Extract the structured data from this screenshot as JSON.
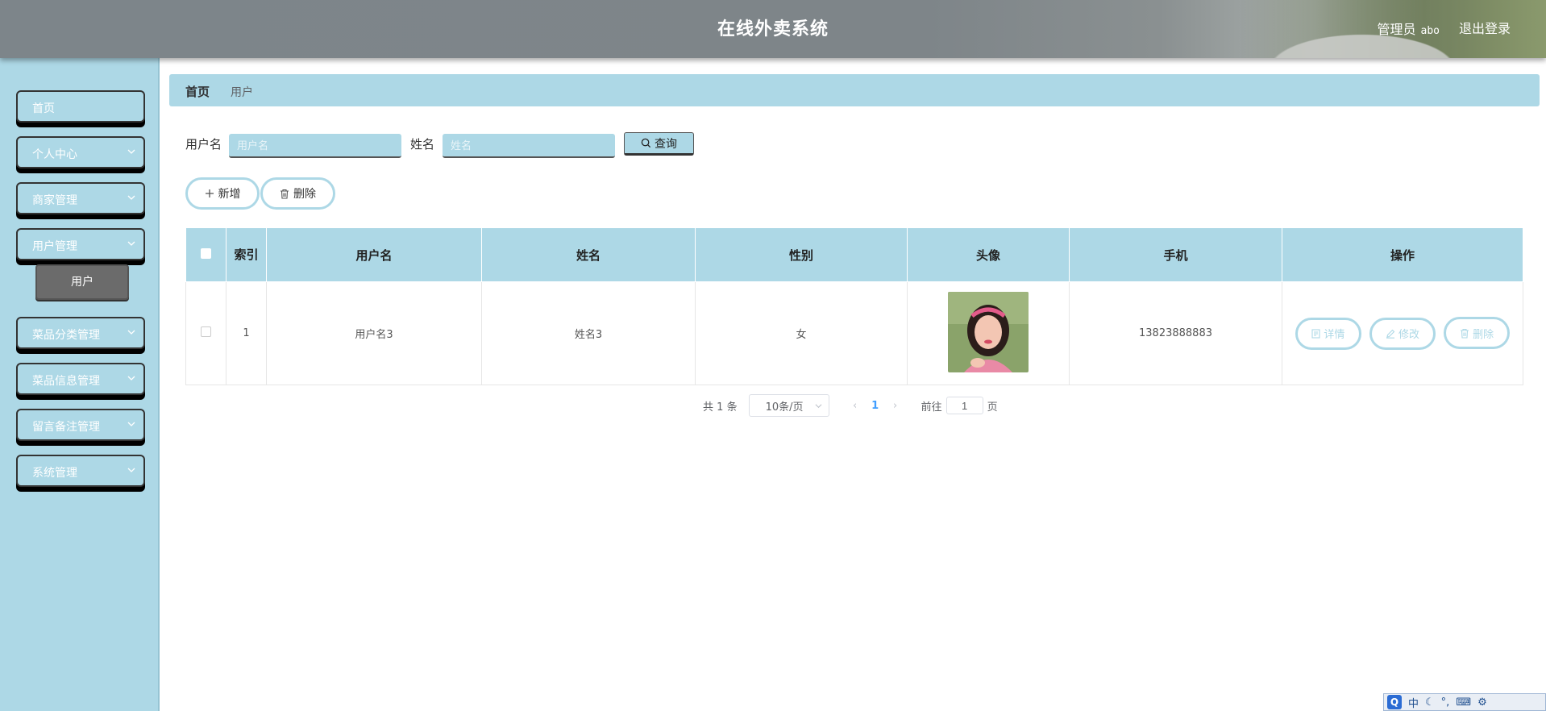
{
  "header": {
    "title": "在线外卖系统",
    "user_role": "管理员",
    "user_name": "abo",
    "logout": "退出登录"
  },
  "sidebar": {
    "items": [
      {
        "label": "首页"
      },
      {
        "label": "个人中心"
      },
      {
        "label": "商家管理"
      },
      {
        "label": "用户管理"
      },
      {
        "label": "菜品分类管理"
      },
      {
        "label": "菜品信息管理"
      },
      {
        "label": "留言备注管理"
      },
      {
        "label": "系统管理"
      }
    ],
    "sub_item": "用户"
  },
  "breadcrumb": {
    "home": "首页",
    "current": "用户"
  },
  "search": {
    "username_label": "用户名",
    "username_placeholder": "用户名",
    "name_label": "姓名",
    "name_placeholder": "姓名",
    "query_button": "查询"
  },
  "actions": {
    "add": "新增",
    "delete": "删除"
  },
  "table": {
    "headers": [
      "索引",
      "用户名",
      "姓名",
      "性别",
      "头像",
      "手机",
      "操作"
    ],
    "rows": [
      {
        "index": "1",
        "username": "用户名3",
        "name": "姓名3",
        "gender": "女",
        "phone": "13823888883"
      }
    ],
    "row_buttons": {
      "detail": "详情",
      "edit": "修改",
      "delete": "删除"
    }
  },
  "pagination": {
    "total_prefix": "共",
    "total": "1",
    "total_suffix": "条",
    "page_size": "10条/页",
    "current_page": "1",
    "goto_label": "前往",
    "goto_value": "1",
    "goto_suffix": "页"
  },
  "ime": {
    "mode": "中"
  },
  "colors": {
    "accent": "#add8e6",
    "header": "#7d858a",
    "submenu": "#6b6b6b"
  }
}
